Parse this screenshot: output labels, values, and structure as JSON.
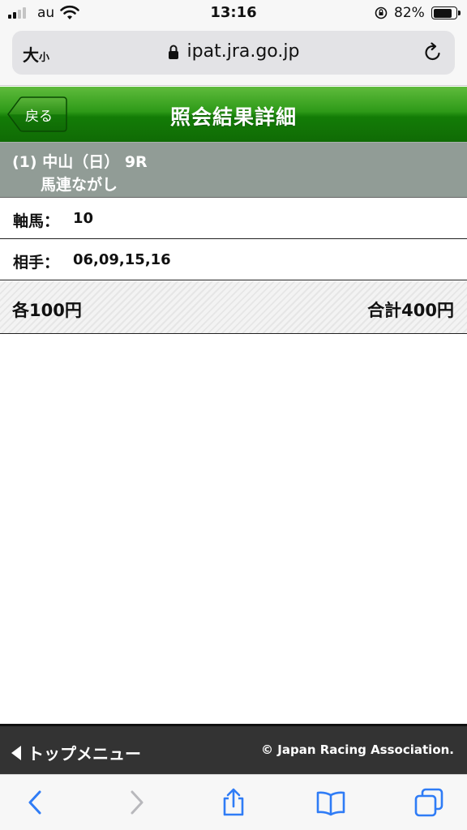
{
  "status_bar": {
    "carrier": "au",
    "time": "13:16",
    "battery_percent": "82%",
    "battery_level": 0.82,
    "icons": [
      "signal-icon",
      "wifi-icon",
      "orientation-lock-icon",
      "battery-icon"
    ]
  },
  "browser": {
    "text_size_button": "大",
    "text_size_small": "小",
    "url": "ipat.jra.go.jp",
    "icons": [
      "lock-icon",
      "reload-icon"
    ]
  },
  "header": {
    "back_label": "戻る",
    "title": "照会結果詳細"
  },
  "race": {
    "line1": "(1) 中山（日） 9R",
    "line2": "馬連ながし"
  },
  "details": [
    {
      "label": "軸馬：",
      "value": "10"
    },
    {
      "label": "相手：",
      "value": "06,09,15,16"
    }
  ],
  "amounts": {
    "each": "各100円",
    "total": "合計400円"
  },
  "footer": {
    "top_menu": "トップメニュー",
    "copyright": "© Japan Racing Association."
  },
  "toolbar": {
    "icons": [
      "back-arrow-icon",
      "forward-arrow-icon",
      "share-icon",
      "bookmarks-icon",
      "tabs-icon"
    ]
  },
  "colors": {
    "header_green": "#137c06",
    "race_band_gray": "#919c96",
    "footer_dark": "#333333",
    "ios_blue": "#2f7cf6"
  }
}
